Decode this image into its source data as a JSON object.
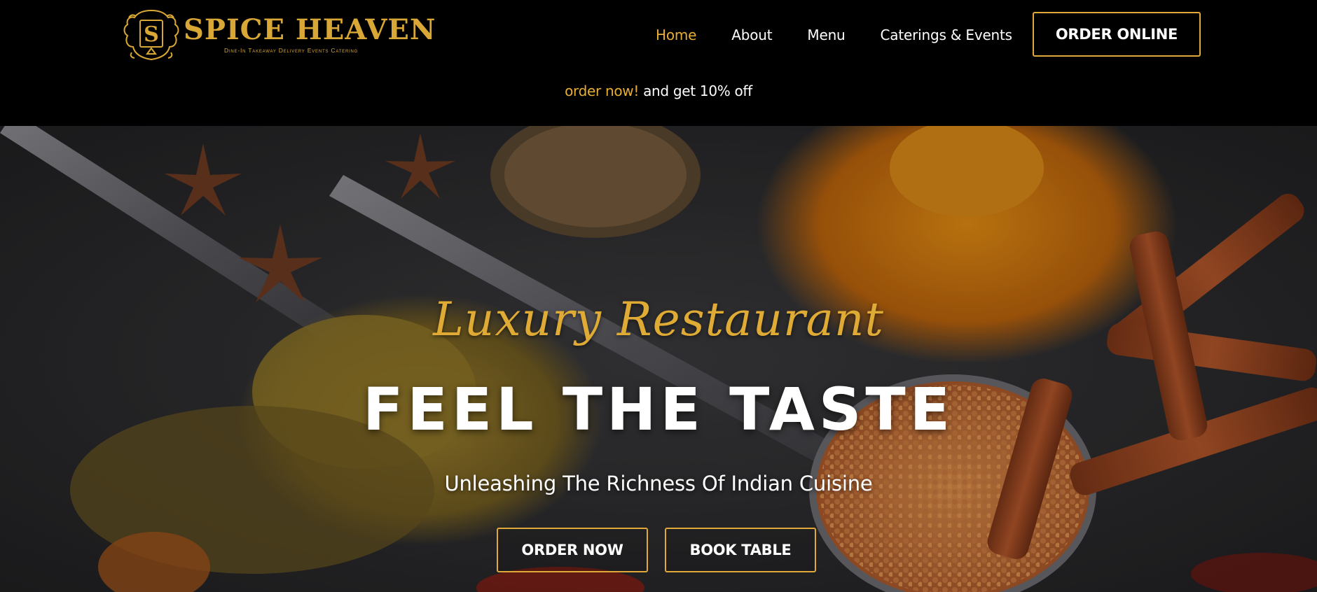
{
  "brand": {
    "name": "SPICE HEAVEN",
    "tagline": "Dine-In Takeaway Delivery Events Catering",
    "emblem_letter": "S",
    "color": "#d9a735"
  },
  "nav": {
    "items": [
      {
        "label": "Home",
        "active": true
      },
      {
        "label": "About",
        "active": false
      },
      {
        "label": "Menu",
        "active": false
      },
      {
        "label": "Caterings & Events",
        "active": false
      }
    ],
    "cta_label": "ORDER ONLINE"
  },
  "promo": {
    "highlight": "order now!",
    "rest": " and get 10% off"
  },
  "hero": {
    "kicker": "Luxury Restaurant",
    "title": "FEEL THE TASTE",
    "subtitle": "Unleashing The Richness Of Indian Cuisine",
    "buttons": {
      "order_label": "ORDER NOW",
      "book_label": "BOOK TABLE"
    },
    "background": "spices-on-dark-slate"
  },
  "colors": {
    "accent": "#e7ae35",
    "background": "#000000",
    "text": "#ffffff"
  }
}
